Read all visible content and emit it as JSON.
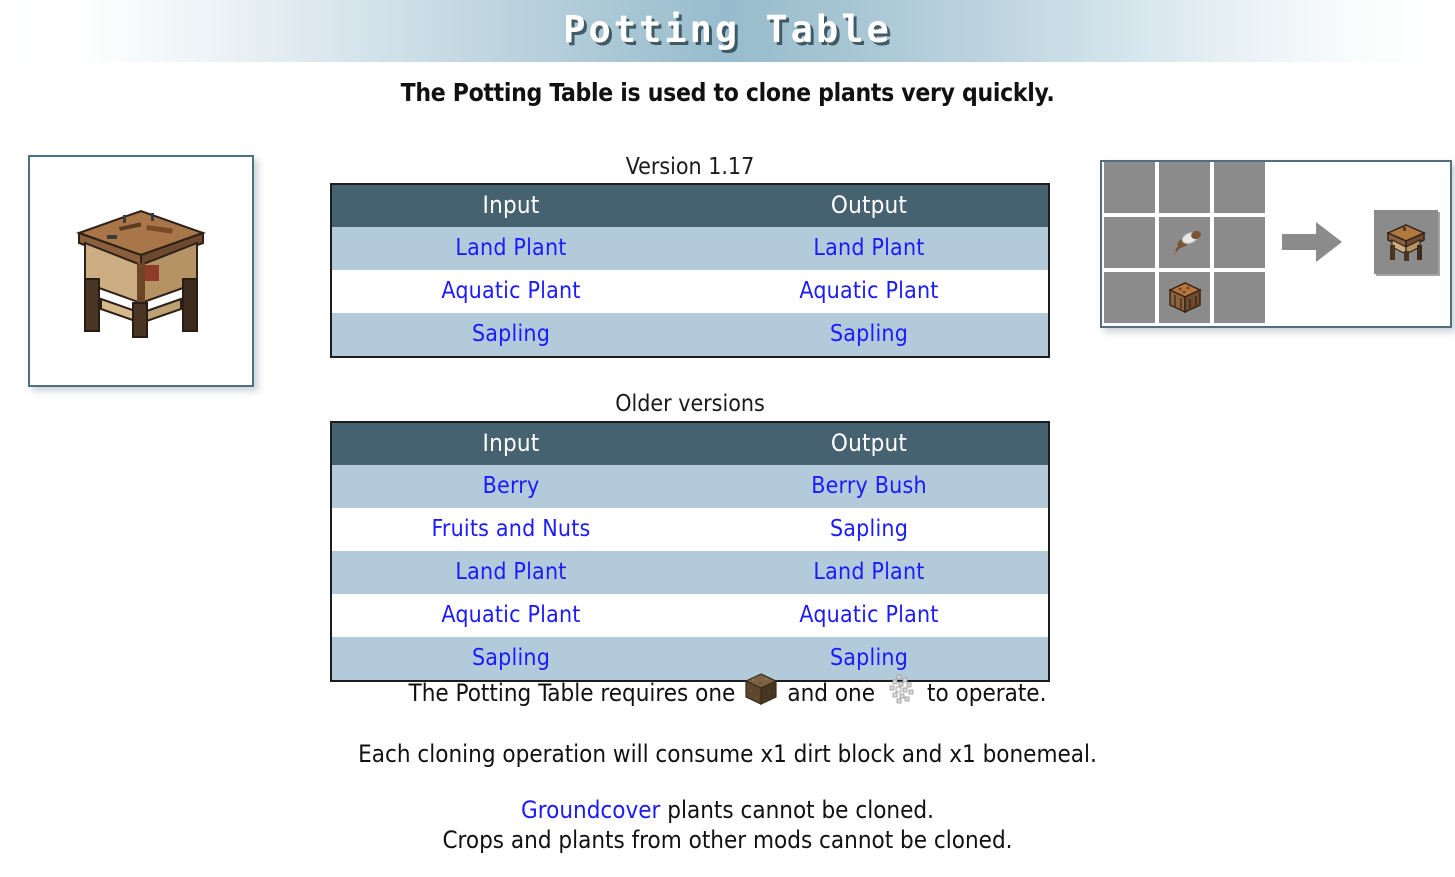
{
  "header": {
    "title": "Potting Table"
  },
  "subtitle": "The Potting Table is used to clone plants very quickly.",
  "left_image": {
    "alt": "potting-table-render"
  },
  "tables": [
    {
      "caption": "Version 1.17",
      "columns": [
        "Input",
        "Output"
      ],
      "rows": [
        [
          "Land Plant",
          "Land Plant"
        ],
        [
          "Aquatic Plant",
          "Aquatic Plant"
        ],
        [
          "Sapling",
          "Sapling"
        ]
      ]
    },
    {
      "caption": "Older versions",
      "columns": [
        "Input",
        "Output"
      ],
      "rows": [
        [
          "Berry",
          "Berry Bush"
        ],
        [
          "Fruits and Nuts",
          "Sapling"
        ],
        [
          "Land Plant",
          "Land Plant"
        ],
        [
          "Aquatic Plant",
          "Aquatic Plant"
        ],
        [
          "Sapling",
          "Sapling"
        ]
      ]
    }
  ],
  "crafting": {
    "grid": [
      [
        "",
        "",
        ""
      ],
      [
        "",
        "feather-item",
        ""
      ],
      [
        "",
        "crafting-table-item",
        ""
      ]
    ],
    "arrow": "arrow-right-icon",
    "output": "potting-table-item"
  },
  "notes": {
    "requires_pre": "The Potting Table requires one",
    "requires_mid": "and one",
    "requires_post": "to operate.",
    "icon_dirt": "dirt-block-icon",
    "icon_bonemeal": "bonemeal-icon",
    "consume": "Each cloning operation will consume x1 dirt block and x1 bonemeal.",
    "groundcover_link": "Groundcover",
    "groundcover_rest": " plants cannot be cloned.",
    "other_mods": "Crops and plants from other mods cannot be cloned."
  },
  "colors": {
    "table_header_bg": "#466270",
    "table_stripe_bg": "#b3cada",
    "link_blue": "#1b1bff",
    "banner_center": "#97bccd",
    "card_border": "#51707f",
    "cell_gray": "#8b8b8b"
  }
}
